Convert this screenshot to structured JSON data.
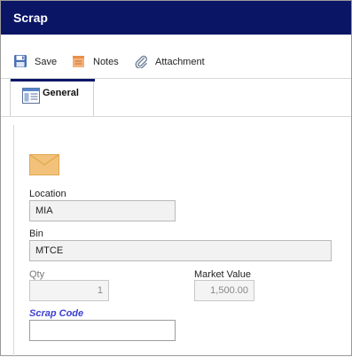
{
  "window": {
    "title": "Scrap"
  },
  "toolbar": {
    "save_label": "Save",
    "notes_label": "Notes",
    "attachment_label": "Attachment"
  },
  "tabs": [
    {
      "label": "General"
    }
  ],
  "form": {
    "location": {
      "label": "Location",
      "value": "MIA"
    },
    "bin": {
      "label": "Bin",
      "value": "MTCE"
    },
    "qty": {
      "label": "Qty",
      "value": "1"
    },
    "market_value": {
      "label": "Market Value",
      "value": "1,500.00"
    },
    "scrap_code": {
      "label": "Scrap Code",
      "value": ""
    }
  },
  "colors": {
    "titlebar": "#0b1566",
    "link": "#3a3fd2",
    "envelope": "#f2c27a"
  }
}
